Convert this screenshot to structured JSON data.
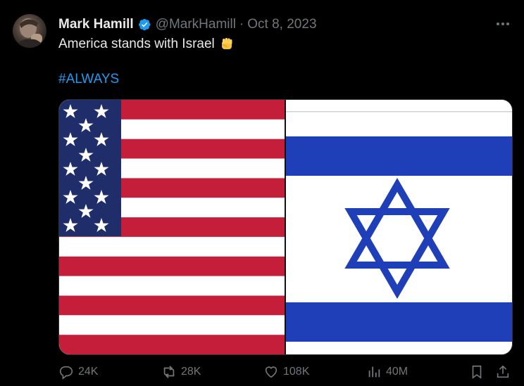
{
  "tweet": {
    "author_name": "Mark Hamill",
    "handle": "@MarkHamill",
    "separator": "·",
    "date": "Oct 8, 2023",
    "text": "America stands with Israel",
    "hashtag": "#ALWAYS"
  },
  "colors": {
    "background": "#000000",
    "accent": "#1d9bf0",
    "muted": "#71767b",
    "us_red": "#c41e3a",
    "us_blue": "#1f2d6b",
    "israel_blue": "#1e3fb8"
  },
  "actions": {
    "replies": "24K",
    "reposts": "28K",
    "likes": "108K",
    "views": "40M"
  },
  "icons": {
    "verified": "verified-badge-icon",
    "more": "more-icon",
    "reply": "reply-icon",
    "repost": "repost-icon",
    "like": "heart-icon",
    "views": "views-icon",
    "bookmark": "bookmark-icon",
    "share": "share-icon"
  }
}
